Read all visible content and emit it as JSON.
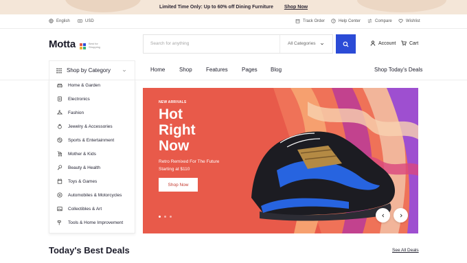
{
  "promo": {
    "text": "Limited Time Only: Up to 60% off Dining Furniture",
    "link": "Shop Now"
  },
  "util": {
    "language": "English",
    "currency": "USD",
    "track": "Track Order",
    "help": "Help Center",
    "compare": "Compare",
    "wishlist": "Wishlist"
  },
  "header": {
    "logo": "Motta",
    "tagline": "Best for Shopping",
    "search_placeholder": "Search for anything",
    "category_select": "All Categories",
    "account": "Account",
    "cart": "Cart"
  },
  "nav": {
    "category_button": "Shop by Category",
    "links": [
      "Home",
      "Shop",
      "Features",
      "Pages",
      "Blog"
    ],
    "deals": "Shop Today's Deals"
  },
  "categories": [
    "Home & Garden",
    "Electronics",
    "Fashion",
    "Jewelry & Accessories",
    "Sports & Entertainment",
    "Mother & Kids",
    "Beauty & Health",
    "Toys & Games",
    "Automobiles & Motorcycles",
    "Collectibles & Art",
    "Tools & Home Improvement"
  ],
  "hero": {
    "eyebrow": "NEW ARRIVALS",
    "title_line1": "Hot",
    "title_line2": "Right",
    "title_line3": "Now",
    "sub_line1": "Retro Remixed For The Future",
    "sub_line2": "Starting at $110",
    "button": "Shop Now",
    "slides": 3,
    "active_slide": 1
  },
  "section": {
    "title": "Today's Best Deals",
    "see_all": "See All Deals"
  },
  "colors": {
    "accent": "#2b4bd6",
    "hero_bg": "#e85a4a",
    "promo_bg": "#f4e6d8"
  }
}
